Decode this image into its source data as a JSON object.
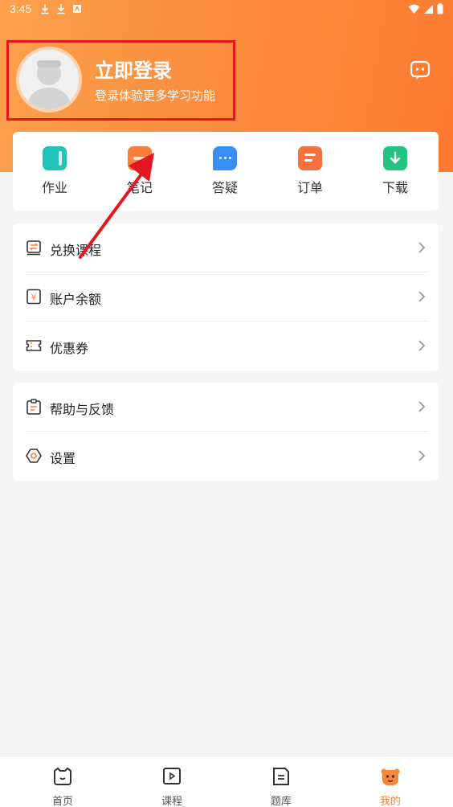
{
  "status": {
    "time": "3:45"
  },
  "profile": {
    "title": "立即登录",
    "subtitle": "登录体验更多学习功能"
  },
  "quick": [
    {
      "label": "作业",
      "icon": "homework-icon",
      "color": "#1fc5b6"
    },
    {
      "label": "笔记",
      "icon": "notes-icon",
      "color": "#f77e3c"
    },
    {
      "label": "答疑",
      "icon": "qa-icon",
      "color": "#3b8ef5"
    },
    {
      "label": "订单",
      "icon": "order-icon",
      "color": "#f8703d"
    },
    {
      "label": "下载",
      "icon": "download-icon",
      "color": "#22c47f"
    }
  ],
  "menu1": [
    {
      "label": "兑换课程",
      "icon": "exchange-icon"
    },
    {
      "label": "账户余额",
      "icon": "balance-icon"
    },
    {
      "label": "优惠券",
      "icon": "coupon-icon"
    }
  ],
  "menu2": [
    {
      "label": "帮助与反馈",
      "icon": "help-icon"
    },
    {
      "label": "设置",
      "icon": "settings-icon"
    }
  ],
  "tabs": [
    {
      "label": "首页",
      "icon": "home-icon"
    },
    {
      "label": "课程",
      "icon": "course-icon"
    },
    {
      "label": "题库",
      "icon": "question-bank-icon"
    },
    {
      "label": "我的",
      "icon": "profile-icon",
      "active": true
    }
  ],
  "colors": {
    "accent": "#f68638",
    "highlight": "#e4161f"
  }
}
